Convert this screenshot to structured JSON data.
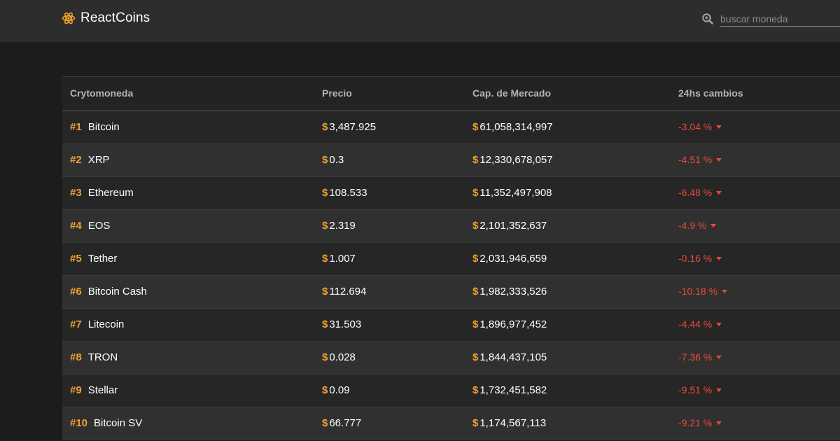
{
  "app": {
    "title": "ReactCoins",
    "logo_icon": "atom-icon",
    "accent_color": "#f0a12e",
    "negative_color": "#e9493a"
  },
  "search": {
    "placeholder": "buscar moneda",
    "value": "",
    "icon": "search-icon"
  },
  "table": {
    "headers": [
      "Crytomoneda",
      "Precio",
      "Cap. de Mercado",
      "24hs cambios"
    ],
    "currency_symbol": "$",
    "percent_suffix": " %",
    "rows": [
      {
        "rank": "#1",
        "name": "Bitcoin",
        "price": "3,487.925",
        "market_cap": "61,058,314,997",
        "change": "-3.04"
      },
      {
        "rank": "#2",
        "name": "XRP",
        "price": "0.3",
        "market_cap": "12,330,678,057",
        "change": "-4.51"
      },
      {
        "rank": "#3",
        "name": "Ethereum",
        "price": "108.533",
        "market_cap": "11,352,497,908",
        "change": "-6.48"
      },
      {
        "rank": "#4",
        "name": "EOS",
        "price": "2.319",
        "market_cap": "2,101,352,637",
        "change": "-4.9"
      },
      {
        "rank": "#5",
        "name": "Tether",
        "price": "1.007",
        "market_cap": "2,031,946,659",
        "change": "-0.16"
      },
      {
        "rank": "#6",
        "name": "Bitcoin Cash",
        "price": "112.694",
        "market_cap": "1,982,333,526",
        "change": "-10.18"
      },
      {
        "rank": "#7",
        "name": "Litecoin",
        "price": "31.503",
        "market_cap": "1,896,977,452",
        "change": "-4.44"
      },
      {
        "rank": "#8",
        "name": "TRON",
        "price": "0.028",
        "market_cap": "1,844,437,105",
        "change": "-7.36"
      },
      {
        "rank": "#9",
        "name": "Stellar",
        "price": "0.09",
        "market_cap": "1,732,451,582",
        "change": "-9.51"
      },
      {
        "rank": "#10",
        "name": "Bitcoin SV",
        "price": "66.777",
        "market_cap": "1,174,567,113",
        "change": "-9.21"
      }
    ]
  }
}
